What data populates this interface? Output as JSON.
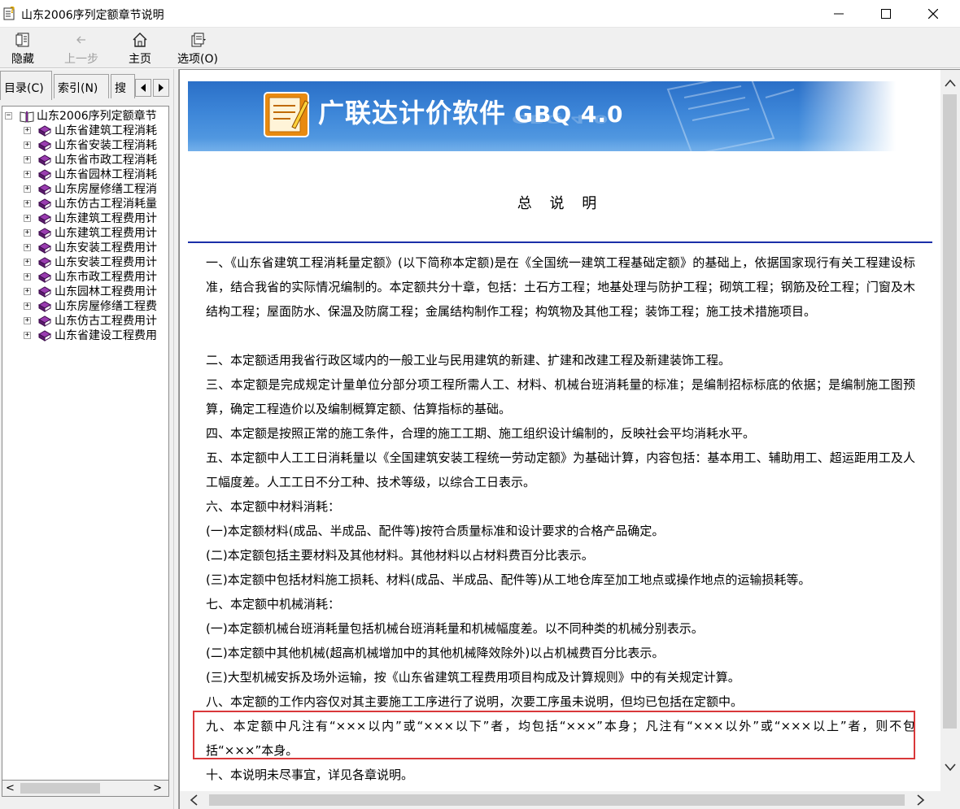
{
  "window": {
    "title": "山东2006序列定额章节说明"
  },
  "toolbar": {
    "hide_label": "隐藏",
    "back_label": "上一步",
    "home_label": "主页",
    "options_label": "选项(O)"
  },
  "nav_tabs": {
    "contents": "目录(C)",
    "index": "索引(N)",
    "search": "搜"
  },
  "tree": {
    "root": "山东2006序列定额章节",
    "items": [
      {
        "label": "山东省建筑工程消耗"
      },
      {
        "label": "山东省安装工程消耗"
      },
      {
        "label": "山东省市政工程消耗"
      },
      {
        "label": "山东省园林工程消耗"
      },
      {
        "label": "山东房屋修缮工程消"
      },
      {
        "label": "山东仿古工程消耗量"
      },
      {
        "label": "山东建筑工程费用计"
      },
      {
        "label": "山东建筑工程费用计"
      },
      {
        "label": "山东安装工程费用计"
      },
      {
        "label": "山东安装工程费用计"
      },
      {
        "label": "山东市政工程费用计"
      },
      {
        "label": "山东园林工程费用计"
      },
      {
        "label": "山东房屋修缮工程费"
      },
      {
        "label": "山东仿古工程费用计"
      },
      {
        "label": "山东省建设工程费用"
      }
    ]
  },
  "banner": {
    "title": "广联达计价软件",
    "version": "GBQ 4.0"
  },
  "document": {
    "heading": "总 说 明",
    "paragraphs": [
      "一、《山东省建筑工程消耗量定额》(以下简称本定额)是在《全国统一建筑工程基础定额》的基础上，依据国家现行有关工程建设标准，结合我省的实际情况编制的。本定额共分十章，包括：土石方工程；地基处理与防护工程；砌筑工程；钢筋及砼工程；门窗及木结构工程；屋面防水、保温及防腐工程；金属结构制作工程；构筑物及其他工程；装饰工程；施工技术措施项目。",
      "二、本定额适用我省行政区域内的一般工业与民用建筑的新建、扩建和改建工程及新建装饰工程。",
      "三、本定额是完成规定计量单位分部分项工程所需人工、材料、机械台班消耗量的标准；是编制招标标底的依据；是编制施工图预算，确定工程造价以及编制概算定额、估算指标的基础。",
      "四、本定额是按照正常的施工条件，合理的施工工期、施工组织设计编制的，反映社会平均消耗水平。",
      "五、本定额中人工工日消耗量以《全国建筑安装工程统一劳动定额》为基础计算，内容包括：基本用工、辅助用工、超运距用工及人工幅度差。人工工日不分工种、技术等级，以综合工日表示。",
      "六、本定额中材料消耗：",
      "(一)本定额材料(成品、半成品、配件等)按符合质量标准和设计要求的合格产品确定。",
      "(二)本定额包括主要材料及其他材料。其他材料以占材料费百分比表示。",
      "(三)本定额中包括材料施工损耗、材料(成品、半成品、配件等)从工地仓库至加工地点或操作地点的运输损耗等。",
      "七、本定额中机械消耗：",
      "(一)本定额机械台班消耗量包括机械台班消耗量和机械幅度差。以不同种类的机械分别表示。",
      "(二)本定额中其他机械(超高机械增加中的其他机械降效除外)以占机械费百分比表示。",
      "(三)大型机械安拆及场外运输，按《山东省建筑工程费用项目构成及计算规则》中的有关规定计算。",
      "八、本定额的工作内容仅对其主要施工工序进行了说明，次要工序虽未说明，但均已包括在定额中。",
      "九、本定额中凡注有“×××以内”或“×××以下”者，均包括“×××”本身；凡注有“×××以外”或“×××以上”者，则不包括“×××”本身。",
      "十、本说明未尽事宜，详见各章说明。"
    ]
  },
  "colors": {
    "banner_blue": "#2a6fc7",
    "rule_blue": "#1b2fa8",
    "highlight_red": "#d9383a",
    "book_purple": "#7a2a8c"
  }
}
